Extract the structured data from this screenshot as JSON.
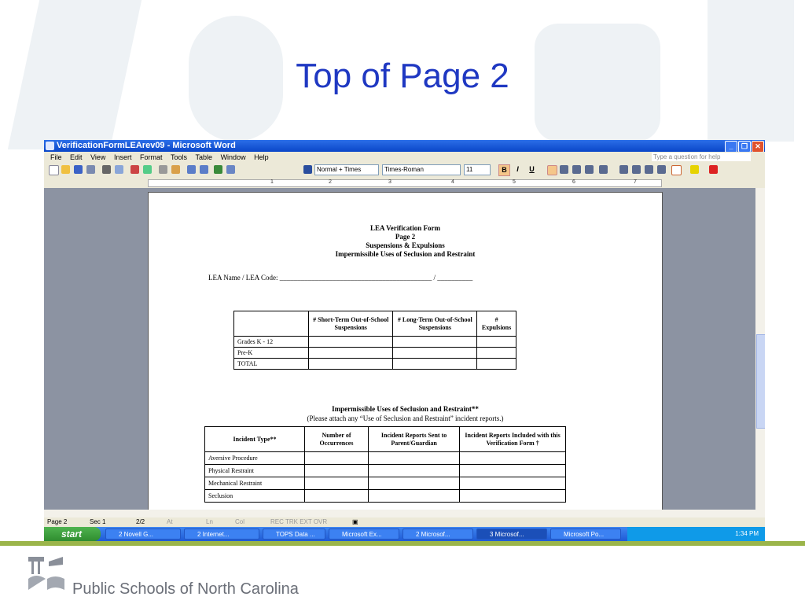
{
  "slide": {
    "title": "Top of Page 2",
    "brand": "Public Schools of North Carolina"
  },
  "window": {
    "title": "VerificationFormLEArev09 - Microsoft Word",
    "menu": [
      "File",
      "Edit",
      "View",
      "Insert",
      "Format",
      "Tools",
      "Table",
      "Window",
      "Help"
    ],
    "help_placeholder": "Type a question for help",
    "style_box": "Normal + Times",
    "font_box": "Times-Roman",
    "size_box": "11",
    "format_buttons": [
      "B",
      "I",
      "U"
    ]
  },
  "ruler": {
    "numbers": [
      "1",
      "2",
      "3",
      "4",
      "5",
      "6",
      "7"
    ]
  },
  "document": {
    "header_lines": [
      "LEA Verification Form",
      "Page 2",
      "Suspensions & Expulsions",
      "Impermissible Uses of Seclusion and Restraint"
    ],
    "lea_label": "LEA Name / LEA Code: ___________________________________________ / __________",
    "table1": {
      "headers": [
        "",
        "# Short-Term Out-of-School Suspensions",
        "# Long-Term Out-of-School Suspensions",
        "# Expulsions"
      ],
      "rows": [
        "Grades K - 12",
        "Pre-K",
        "TOTAL"
      ]
    },
    "section2_title": "Impermissible Uses of Seclusion and Restraint**",
    "section2_subtitle": "(Please attach any “Use of Seclusion and Restraint” incident reports.)",
    "table2": {
      "headers": [
        "Incident Type**",
        "Number of Occurrences",
        "Incident Reports Sent to Parent/Guardian",
        "Incident Reports Included with this Verification Form †"
      ],
      "rows": [
        "Aversive Procedure",
        "Physical Restraint",
        "Mechanical Restraint",
        "Seclusion"
      ]
    }
  },
  "status": {
    "page": "Page 2",
    "sec": "Sec 1",
    "count": "2/2",
    "at": "At",
    "ln": "Ln",
    "col": "Col",
    "modes": "REC  TRK  EXT  OVR"
  },
  "taskbar": {
    "start": "start",
    "tasks": [
      "2 Novell G...",
      "2 Internet...",
      "TOPS Data ...",
      "Microsoft Ex...",
      "2 Microsof...",
      "3 Microsof...",
      "Microsoft Po..."
    ],
    "clock": "1:34 PM"
  },
  "colors": {
    "title": "#1f38c2",
    "xp_blue": "#0a46c8",
    "green_band": "#9bb54a"
  }
}
